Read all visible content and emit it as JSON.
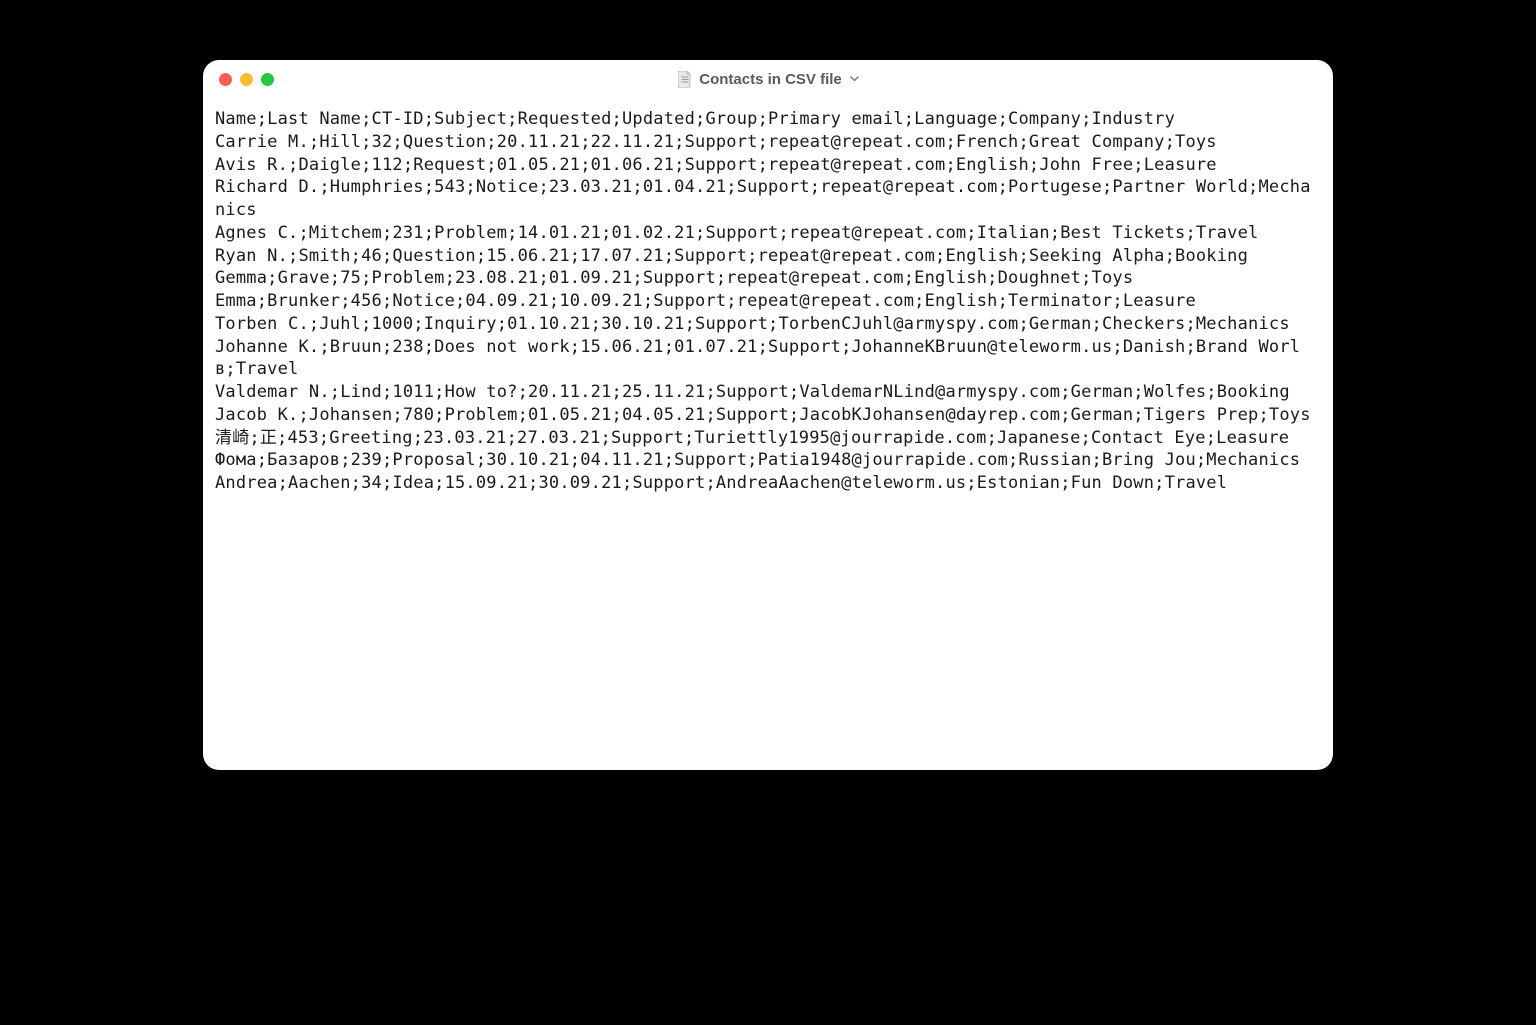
{
  "window": {
    "title": "Contacts in CSV file"
  },
  "csvContent": "Name;Last Name;CT-ID;Subject;Requested;Updated;Group;Primary email;Language;Company;Industry\nCarrie M.;Hill;32;Question;20.11.21;22.11.21;Support;repeat@repeat.com;French;Great Company;Toys\nAvis R.;Daigle;112;Request;01.05.21;01.06.21;Support;repeat@repeat.com;English;John Free;Leasure\nRichard D.;Humphries;543;Notice;23.03.21;01.04.21;Support;repeat@repeat.com;Portugese;Partner World;Mechanics\nAgnes C.;Mitchem;231;Problem;14.01.21;01.02.21;Support;repeat@repeat.com;Italian;Best Tickets;Travel\nRyan N.;Smith;46;Question;15.06.21;17.07.21;Support;repeat@repeat.com;English;Seeking Alpha;Booking\nGemma;Grave;75;Problem;23.08.21;01.09.21;Support;repeat@repeat.com;English;Doughnet;Toys\nEmma;Brunker;456;Notice;04.09.21;10.09.21;Support;repeat@repeat.com;English;Terminator;Leasure\nTorben C.;Juhl;1000;Inquiry;01.10.21;30.10.21;Support;TorbenCJuhl@armyspy.com;German;Checkers;Mechanics\nJohanne K.;Bruun;238;Does not work;15.06.21;01.07.21;Support;JohanneKBruun@teleworm.us;Danish;Brand Worlв;Travel\nValdemar N.;Lind;1011;How to?;20.11.21;25.11.21;Support;ValdemarNLind@armyspy.com;German;Wolfes;Booking\nJacob K.;Johansen;780;Problem;01.05.21;04.05.21;Support;JacobKJohansen@dayrep.com;German;Tigers Prep;Toys\n清崎;正;453;Greeting;23.03.21;27.03.21;Support;Turiettly1995@jourrapide.com;Japanese;Contact Eye;Leasure\nФома;Базаров;239;Proposal;30.10.21;04.11.21;Support;Patia1948@jourrapide.com;Russian;Bring Jou;Mechanics\nAndrea;Aachen;34;Idea;15.09.21;30.09.21;Support;AndreaAachen@teleworm.us;Estonian;Fun Down;Travel"
}
